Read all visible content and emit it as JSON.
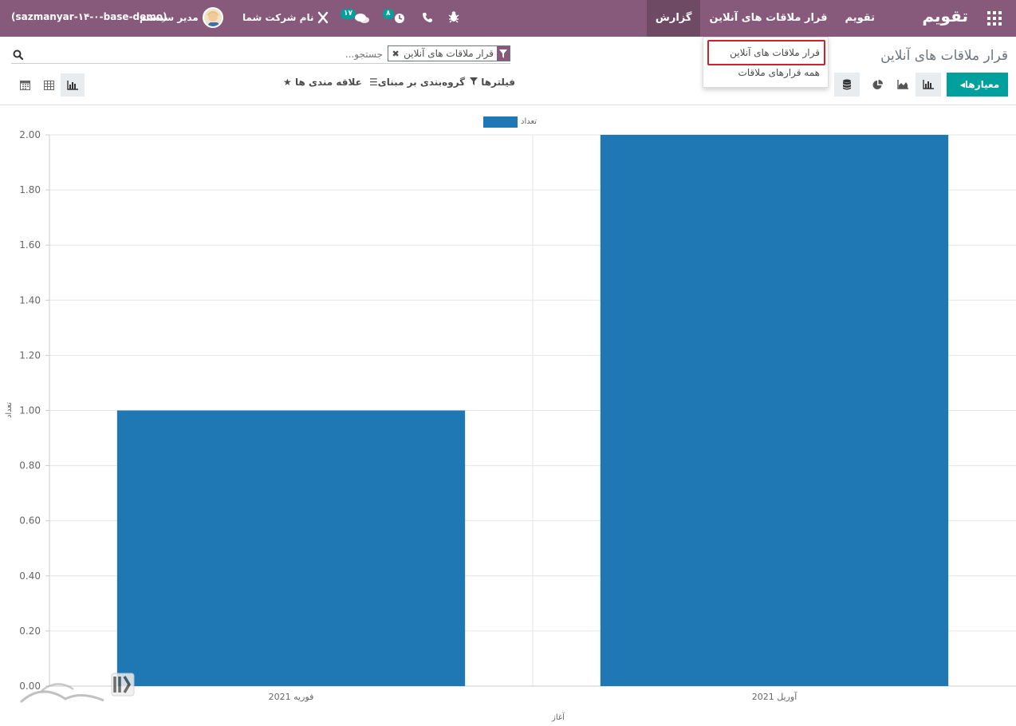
{
  "navbar": {
    "brand": "تقویم",
    "menu": [
      "تقویم",
      "قرار ملاقات های آنلاین",
      "گزارش"
    ],
    "company": "نام شرکت شما",
    "user": "مدیر سیستم",
    "database": "(sazmanyar-۱۴-۰-base-demo)",
    "messages_count": "۱۷",
    "activities_count": "۸"
  },
  "dropdown": {
    "items": [
      "قرار ملاقات های آنلاین",
      "همه قرارهای ملاقات"
    ]
  },
  "page": {
    "title": "قرار ملاقات های آنلاین"
  },
  "search": {
    "facet": "قرار ملاقات های آنلاین",
    "placeholder": "جستجو..."
  },
  "search_options": {
    "filters": "فیلترها",
    "group_by": "گروه‌بندی بر مبنای",
    "favorites": "علاقه مندی ها"
  },
  "toolbar": {
    "measures": "معیارها"
  },
  "colors": {
    "navbar": "#875a7b",
    "accent": "#00a09d",
    "bar": "#1f77b4",
    "highlight": "#d0202a"
  },
  "chart_data": {
    "type": "bar",
    "categories": [
      "فوریه 2021",
      "آوریل 2021"
    ],
    "series": [
      {
        "name": "تعداد",
        "values": [
          1,
          2
        ]
      }
    ],
    "xlabel": "آغاز",
    "ylabel": "تعداد",
    "ylim": [
      0,
      2
    ],
    "yticks": [
      "0.00",
      "0.20",
      "0.40",
      "0.60",
      "0.80",
      "1.00",
      "1.20",
      "1.40",
      "1.60",
      "1.80",
      "2.00"
    ],
    "grid": true,
    "legend": "top-center"
  }
}
